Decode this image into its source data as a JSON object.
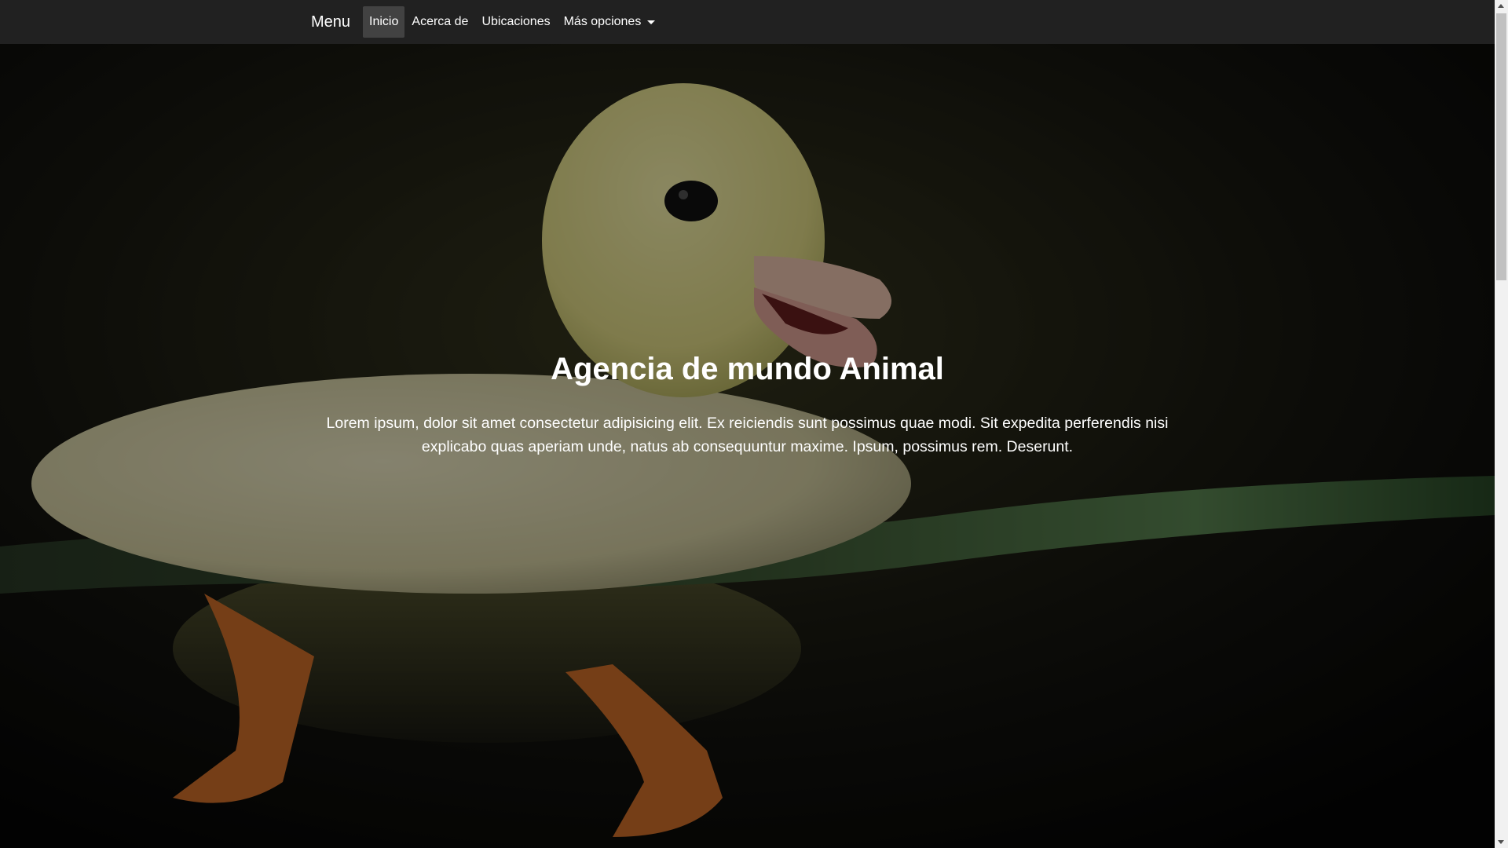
{
  "navbar": {
    "brand": "Menu",
    "items": [
      {
        "label": "Inicio",
        "active": true
      },
      {
        "label": "Acerca de",
        "active": false
      },
      {
        "label": "Ubicaciones",
        "active": false
      },
      {
        "label": "Más opciones",
        "active": false,
        "dropdown": true
      }
    ]
  },
  "hero": {
    "title": "Agencia de mundo Animal",
    "text": "Lorem ipsum, dolor sit amet consectetur adipisicing elit. Ex reiciendis sunt possimus quae modi. Sit expedita perferendis nisi explicabo quas aperiam unde, natus ab consequuntur maxime. Ipsum, possimus rem. Deserunt.",
    "background_image": "duckling-swimming"
  },
  "colors": {
    "navbar_bg": "#212121",
    "active_bg": "#424242",
    "text": "#ffffff"
  }
}
